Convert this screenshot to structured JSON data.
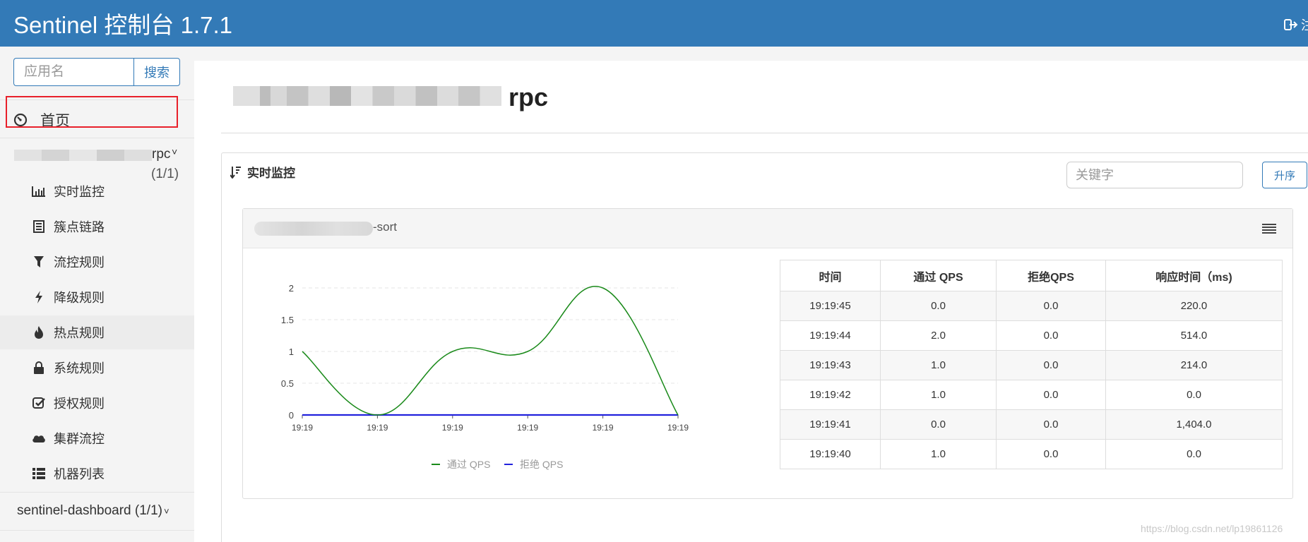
{
  "header": {
    "title": "Sentinel 控制台 1.7.1",
    "logout_label": "注"
  },
  "sidebar": {
    "search_placeholder": "应用名",
    "search_button": "搜索",
    "home_label": "首页",
    "app": {
      "name_suffix": "rpc",
      "count": "(1/1)"
    },
    "menu": [
      {
        "label": "实时监控",
        "icon": "bar-chart-icon"
      },
      {
        "label": "簇点链路",
        "icon": "list-icon"
      },
      {
        "label": "流控规则",
        "icon": "filter-icon"
      },
      {
        "label": "降级规则",
        "icon": "bolt-icon"
      },
      {
        "label": "热点规则",
        "icon": "fire-icon"
      },
      {
        "label": "系统规则",
        "icon": "lock-icon"
      },
      {
        "label": "授权规则",
        "icon": "check-icon"
      },
      {
        "label": "集群流控",
        "icon": "cloud-icon"
      },
      {
        "label": "机器列表",
        "icon": "table-list-icon"
      }
    ],
    "dashboard_item": "sentinel-dashboard  (1/1)"
  },
  "main": {
    "title_suffix": "rpc",
    "panel_title": "实时监控",
    "keyword_placeholder": "关键字",
    "sort_button": "升序",
    "resource": {
      "name_suffix": "-sort"
    },
    "table": {
      "headers": [
        "时间",
        "通过 QPS",
        "拒绝QPS",
        "响应时间（ms)"
      ],
      "rows": [
        [
          "19:19:45",
          "0.0",
          "0.0",
          "220.0"
        ],
        [
          "19:19:44",
          "2.0",
          "0.0",
          "514.0"
        ],
        [
          "19:19:43",
          "1.0",
          "0.0",
          "214.0"
        ],
        [
          "19:19:42",
          "1.0",
          "0.0",
          "0.0"
        ],
        [
          "19:19:41",
          "0.0",
          "0.0",
          "1,404.0"
        ],
        [
          "19:19:40",
          "1.0",
          "0.0",
          "0.0"
        ]
      ]
    }
  },
  "chart_data": {
    "type": "line",
    "x": [
      "19:19",
      "19:19",
      "19:19",
      "19:19",
      "19:19",
      "19:19"
    ],
    "y_ticks": [
      "0",
      "0.5",
      "1",
      "1.5",
      "2"
    ],
    "ylim": [
      0,
      2
    ],
    "grid": true,
    "legend_position": "bottom",
    "series": [
      {
        "name": "通过 QPS",
        "values": [
          1,
          0,
          1,
          1,
          2,
          0
        ],
        "color": "#1a8a1a"
      },
      {
        "name": "拒绝 QPS",
        "values": [
          0,
          0,
          0,
          0,
          0,
          0
        ],
        "color": "#2222dd"
      }
    ]
  },
  "watermark": "https://blog.csdn.net/lp19861126"
}
